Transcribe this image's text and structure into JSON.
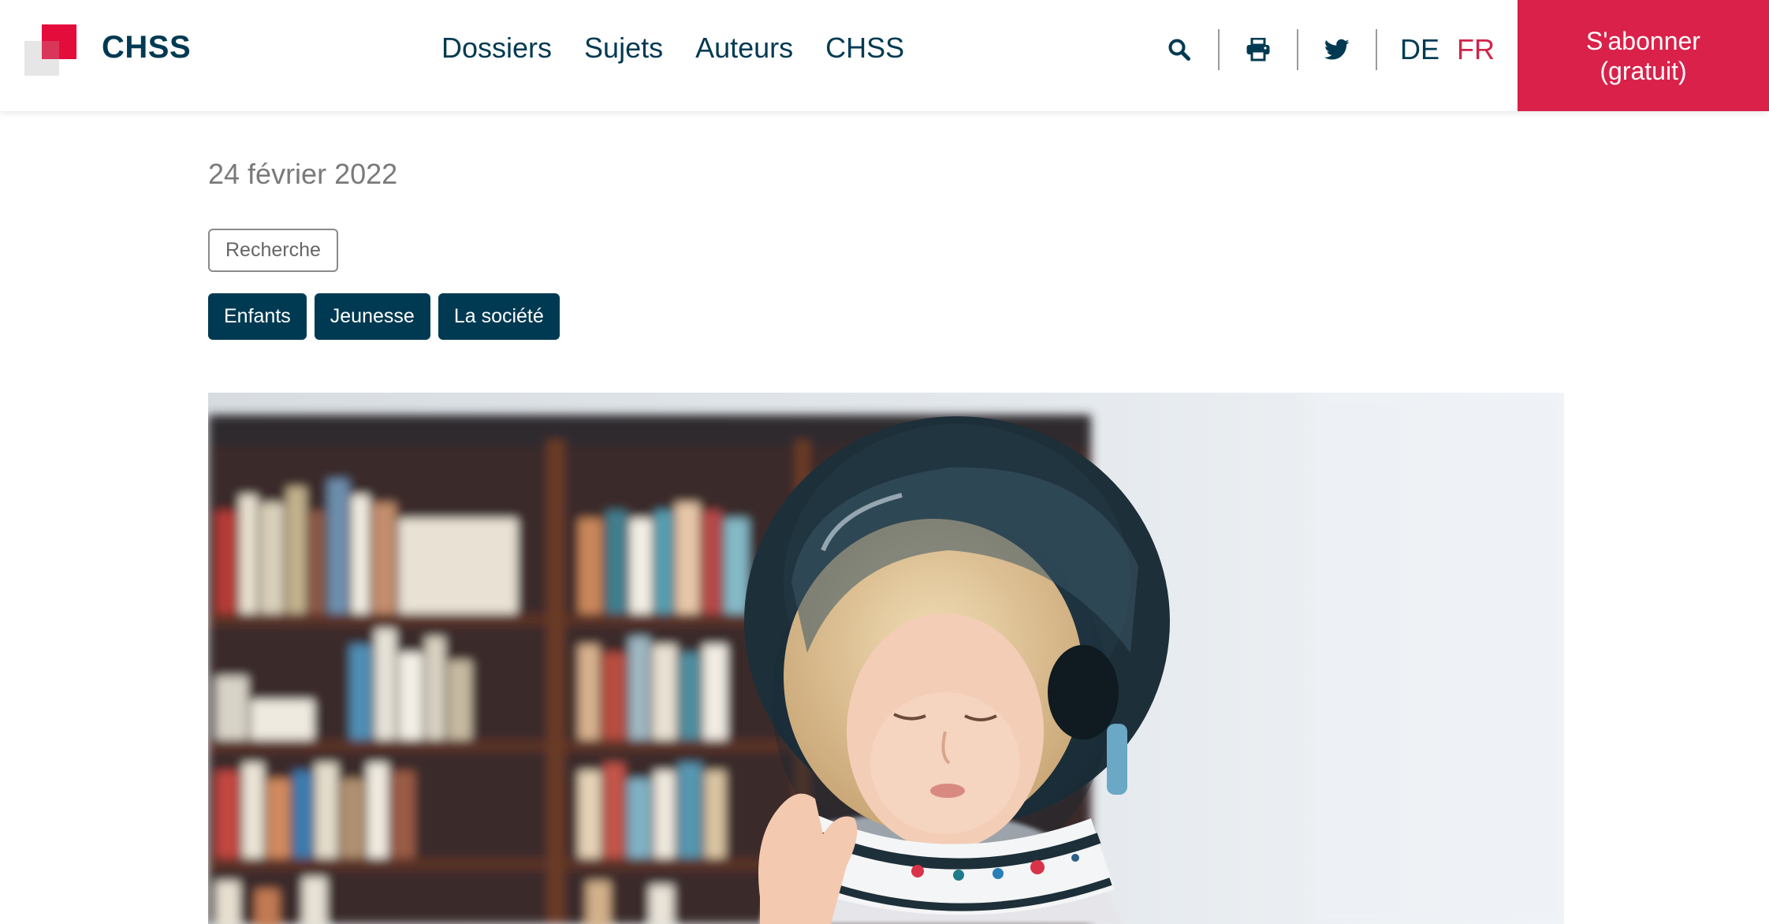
{
  "brand": {
    "name": "CHSS"
  },
  "nav": {
    "items": [
      {
        "label": "Dossiers"
      },
      {
        "label": "Sujets"
      },
      {
        "label": "Auteurs"
      },
      {
        "label": "CHSS"
      }
    ]
  },
  "tools": {
    "icons": [
      "search-icon",
      "print-icon",
      "twitter-icon"
    ],
    "languages": [
      {
        "label": "DE",
        "active": false
      },
      {
        "label": "FR",
        "active": true
      }
    ]
  },
  "subscribe": {
    "line1": "S'abonner",
    "line2": "(gratuit)"
  },
  "article": {
    "date": "24 février 2022",
    "category": "Recherche",
    "tags": [
      "Enfants",
      "Jeunesse",
      "La société"
    ]
  },
  "colors": {
    "primary": "#003a52",
    "accent": "#d9214a",
    "logo_red": "#e30c3b",
    "active_lang": "#cf2449",
    "muted_text": "#7a7a7a"
  }
}
